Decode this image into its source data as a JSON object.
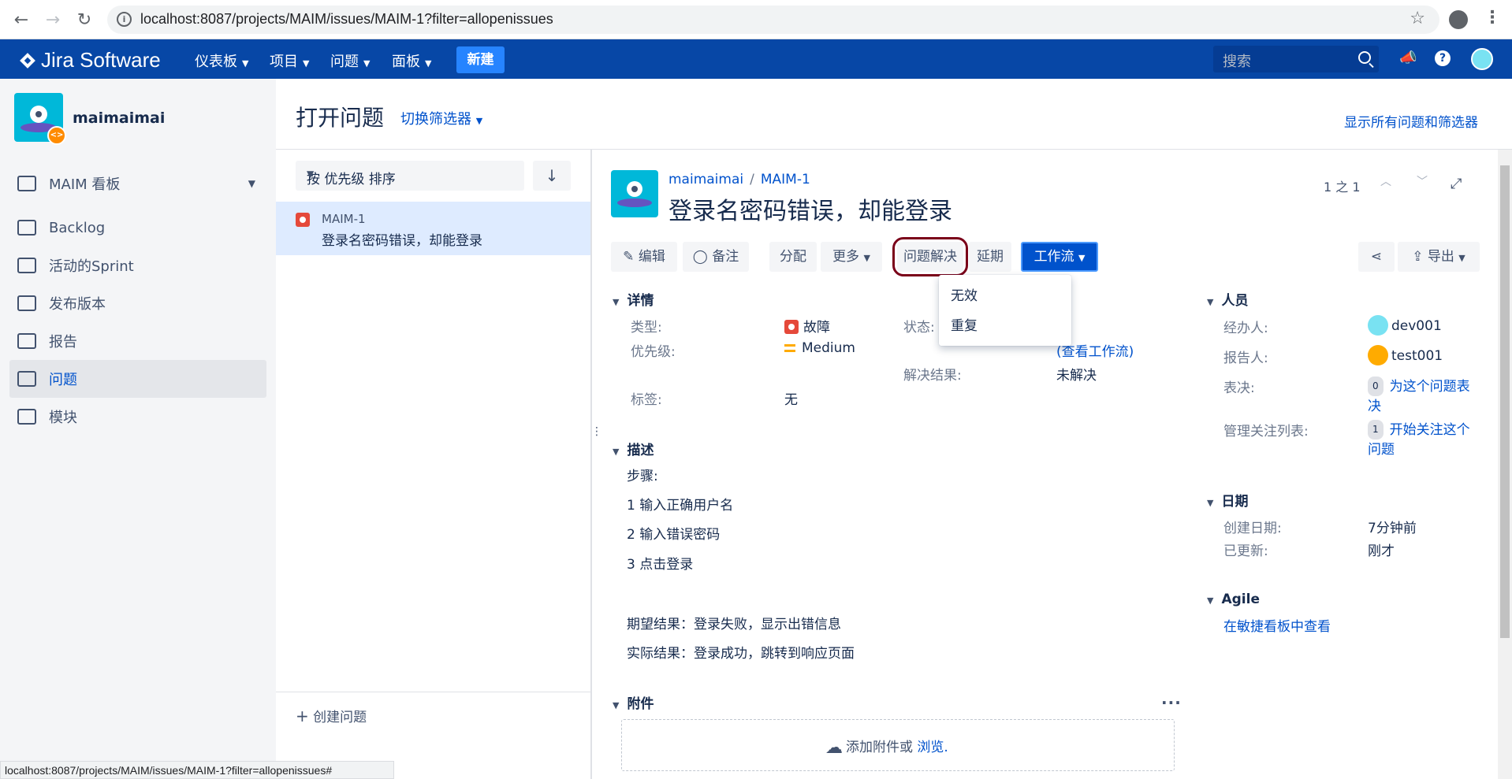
{
  "browser": {
    "url": "localhost:8087/projects/MAIM/issues/MAIM-1?filter=allopenissues"
  },
  "topnav": {
    "brand": "Jira Software",
    "items": [
      "仪表板",
      "项目",
      "问题",
      "面板"
    ],
    "create_label": "新建",
    "search_placeholder": "搜索"
  },
  "sidebar": {
    "project_name": "maimaimai",
    "items": [
      {
        "label": "MAIM 看板",
        "icon": "board-icon"
      },
      {
        "label": "Backlog",
        "icon": "backlog-icon"
      },
      {
        "label": "活动的Sprint",
        "icon": "sprint-icon"
      },
      {
        "label": "发布版本",
        "icon": "ship-icon"
      },
      {
        "label": "报告",
        "icon": "chart-icon"
      },
      {
        "label": "问题",
        "icon": "issues-icon"
      },
      {
        "label": "模块",
        "icon": "components-icon"
      }
    ]
  },
  "header": {
    "title": "打开问题",
    "switch_filter": "切换筛选器",
    "show_all": "显示所有问题和筛选器"
  },
  "list": {
    "sort_label": "按 优先级 排序",
    "sort_direction_icon": "↓",
    "items": [
      {
        "key": "MAIM-1",
        "summary": "登录名密码错误，却能登录"
      }
    ],
    "create_issue": "创建问题"
  },
  "issue": {
    "project": "maimaimai",
    "key": "MAIM-1",
    "title": "登录名密码错误，却能登录",
    "pager": "1 之 1",
    "toolbar": {
      "edit": "编辑",
      "comment": "备注",
      "assign": "分配",
      "more": "更多",
      "resolve": "问题解决",
      "defer": "延期",
      "workflow": "工作流",
      "export": "导出"
    },
    "workflow_menu": [
      "无效",
      "重复"
    ],
    "details": {
      "section": "详情",
      "type_label": "类型:",
      "type_value": "故障",
      "priority_label": "优先级:",
      "priority_value": "Medium",
      "labels_label": "标签:",
      "labels_value": "无",
      "status_label": "状态:",
      "view_workflow": "(查看工作流)",
      "resolution_label": "解决结果:",
      "resolution_value": "未解决"
    },
    "description": {
      "section": "描述",
      "lines": [
        "步骤:",
        "1 输入正确用户名",
        "2 输入错误密码",
        "3 点击登录",
        "期望结果：登录失败，显示出错信息",
        "实际结果：登录成功，跳转到响应页面"
      ]
    },
    "attachments": {
      "section": "附件",
      "add_text": "添加附件或",
      "browse": "浏览."
    },
    "people": {
      "section": "人员",
      "assignee_label": "经办人:",
      "assignee": "dev001",
      "reporter_label": "报告人:",
      "reporter": "test001",
      "votes_label": "表决:",
      "votes_count": "0",
      "votes_link": "为这个问题表决",
      "watchers_label": "管理关注列表:",
      "watchers_count": "1",
      "watchers_link": "开始关注这个问题"
    },
    "dates": {
      "section": "日期",
      "created_label": "创建日期:",
      "created": "7分钟前",
      "updated_label": "已更新:",
      "updated": "刚才"
    },
    "agile": {
      "section": "Agile",
      "link": "在敏捷看板中查看"
    }
  },
  "statusbar": "localhost:8087/projects/MAIM/issues/MAIM-1?filter=allopenissues#",
  "colors": {
    "nav": "#0747a6",
    "link": "#0052cc",
    "highlight": "#7a0019"
  }
}
